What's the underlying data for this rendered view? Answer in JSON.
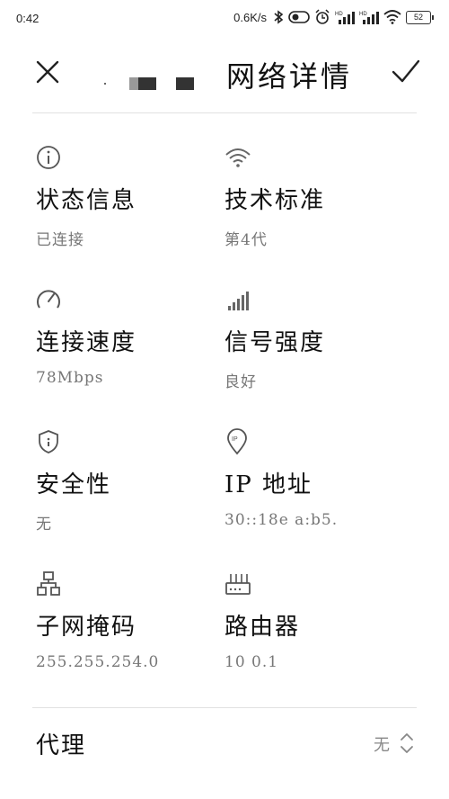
{
  "status_bar": {
    "time": "0:42",
    "speed": "0.6K/s",
    "battery": "52"
  },
  "header": {
    "title": "网络详情",
    "close_icon": "close-icon",
    "confirm_icon": "check-icon"
  },
  "details": [
    {
      "icon": "info-icon",
      "title": "状态信息",
      "value": "已连接"
    },
    {
      "icon": "wifi-icon",
      "title": "技术标准",
      "value": "第4代"
    },
    {
      "icon": "speedometer-icon",
      "title": "连接速度",
      "value": "78Mbps"
    },
    {
      "icon": "signal-bars-icon",
      "title": "信号强度",
      "value": "良好"
    },
    {
      "icon": "shield-icon",
      "title": "安全性",
      "value": "无"
    },
    {
      "icon": "ip-location-icon",
      "title": "IP 地址",
      "value": "30::18e          a:b5."
    },
    {
      "icon": "network-topology-icon",
      "title": "子网掩码",
      "value": "255.255.254.0"
    },
    {
      "icon": "router-icon",
      "title": "路由器",
      "value": "10       0.1"
    }
  ],
  "proxy": {
    "label": "代理",
    "value": "无"
  }
}
